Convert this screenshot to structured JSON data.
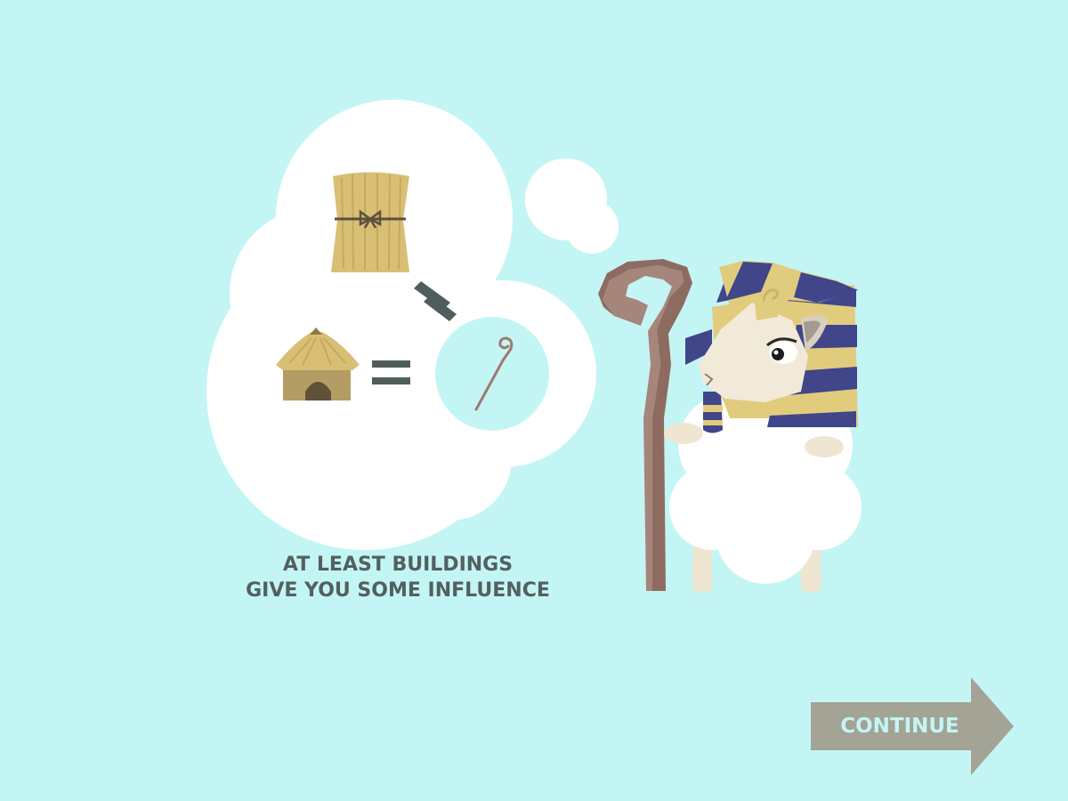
{
  "message": {
    "line1": "AT LEAST BUILDINGS",
    "line2": "GIVE YOU SOME INFLUENCE"
  },
  "continue_button": {
    "label": "CONTINUE"
  },
  "icons": {
    "resource": "wheat-bundle-icon",
    "building": "straw-hut-icon",
    "influence": "shepherd-crook-icon",
    "character": "pharaoh-sheep"
  },
  "colors": {
    "background": "#c4f5f5",
    "bubble": "#ffffff",
    "text": "#53605f",
    "button": "#a3a396",
    "button_text": "#c4f5f5",
    "straw": "#d9bf75",
    "headdress_gold": "#e1cc7d",
    "headdress_blue": "#41458a"
  }
}
